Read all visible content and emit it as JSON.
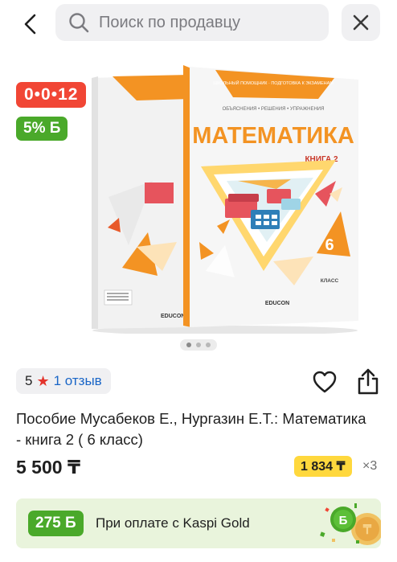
{
  "search": {
    "placeholder": "Поиск по продавцу"
  },
  "badges": {
    "installment": "0•0•12",
    "bonus": "5% Б"
  },
  "gallery": {
    "slides": 3,
    "active": 1
  },
  "book_cover": {
    "series": "ШКОЛЬНЫЙ ПОМОЩНИК · ПОДГОТОВКА К ЭКЗАМЕНАМ",
    "subtitle": "ОБЪЯСНЕНИЯ • РЕШЕНИЯ • УПРАЖНЕНИЯ",
    "title": "МАТЕМАТИКА",
    "book": "КНИГА 2",
    "grade_number": "6",
    "grade_label": "КЛАСС",
    "publisher": "EDUCON"
  },
  "rating": {
    "value": "5",
    "reviews": "1 отзыв"
  },
  "product": {
    "title": "Пособие Мусабеков Е., Нургазин Е.Т.: Математика - книга 2 ( 6 класс)"
  },
  "price": {
    "main": "5 500 ₸",
    "installment": "1 834 ₸",
    "months": "×3"
  },
  "kaspi": {
    "bonus": "275 Б",
    "text": "При оплате с Kaspi Gold"
  },
  "colors": {
    "red": "#f14635",
    "green": "#4aa92a",
    "yellow": "#ffd83d",
    "link": "#1a66c7",
    "orange": "#f39323"
  }
}
